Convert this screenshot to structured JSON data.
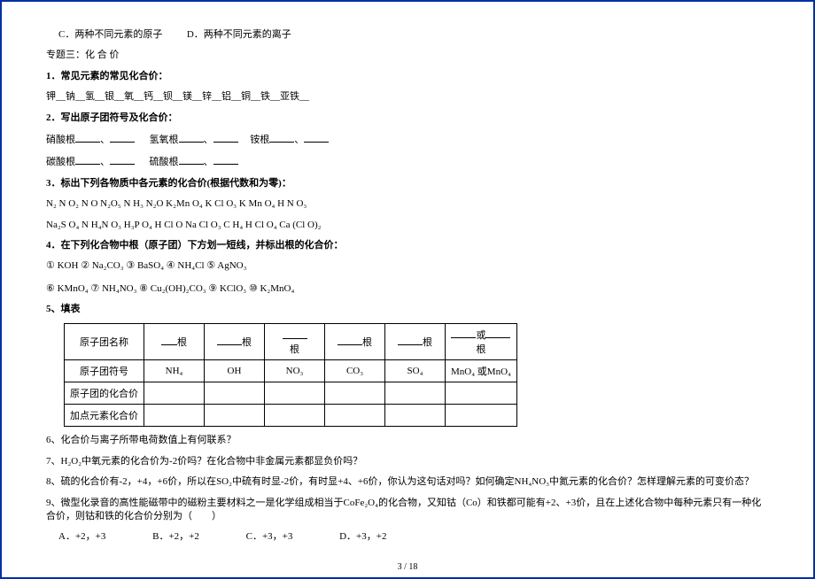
{
  "top_options": {
    "c": "C．两种不同元素的原子",
    "d": "D．两种不同元素的离子"
  },
  "topic3_title": "专题三：化 合 价",
  "q1": {
    "heading": "1．常见元素的常见化合价：",
    "elements": "钾__钠__氢__银__氧__钙__钡__镁__锌__铝__铜__铁__亚铁__"
  },
  "q2": {
    "heading": "2．写出原子团符号及化合价：",
    "line1_a": "硝酸根",
    "line1_b": "氢氧根",
    "line1_c": "铵根",
    "line2_a": "碳酸根",
    "line2_b": "硫酸根"
  },
  "q3": {
    "heading": "3．标出下列各物质中各元素的化合价(根据代数和为零)：",
    "row1": "N₂   N O₂   N O   N₂O₅   N H₃   N₂O   K₂Mn O₄   K Cl O₃   K Mn O₄   H N O₃",
    "row2": "Na₂S O₄   N H₄N O₃   H₃P O₄   H Cl O   Na Cl O₃   C H₄   H Cl O₄   Ca (Cl O)₂"
  },
  "q4": {
    "heading": "4．在下列化合物中根（原子团）下方划一短线，并标出根的化合价：",
    "items_row1": "① KOH    ② Na₂CO₃    ③ BaSO₄    ④ NH₄Cl    ⑤ AgNO₃",
    "items_row2": "⑥ KMnO₄    ⑦ NH₄NO₃    ⑧ Cu₂(OH)₂CO₃    ⑨ KClO₃    ⑩ K₂MnO₄"
  },
  "q5": {
    "heading": "5、填表",
    "table": {
      "headers": [
        "原子团名称",
        "__根",
        "____根",
        "____\n根",
        "____根",
        "____根",
        "____或____\n根"
      ],
      "row_symbol_label": "原子团符号",
      "symbols": [
        "NH₄",
        "OH",
        "NO₃",
        "CO₃",
        "SO₄",
        "MnO₄ 或MnO₄"
      ],
      "row_valence_label": "原子团的化合价",
      "row_dotted_label": "加点元素化合价"
    }
  },
  "q6": "6、化合价与离子所带电荷数值上有何联系？",
  "q7": "7、H₂O₂中氧元素的化合价为-2价吗？在化合物中非金属元素都显负价吗？",
  "q8": "8、硫的化合价有-2，+4，+6价，所以在SO₂中硫有时显-2价，有时显+4、+6价，你认为这句话对吗？如何确定NH₄NO₃中氮元素的化合价？怎样理解元素的可变价态？",
  "q9": {
    "text": "9、微型化录音的高性能磁带中的磁粉主要材料之一是化学组成相当于CoFe₂O₄的化合物，又知钴（Co）和铁都可能有+2、+3价，且在上述化合物中每种元素只有一种化合价，则钴和铁的化合价分别为（　　）",
    "options": {
      "a": "A．+2，+3",
      "b": "B．+2，+2",
      "c": "C．+3，+3",
      "d": "D．+3，+2"
    }
  },
  "footer": "3 / 18"
}
